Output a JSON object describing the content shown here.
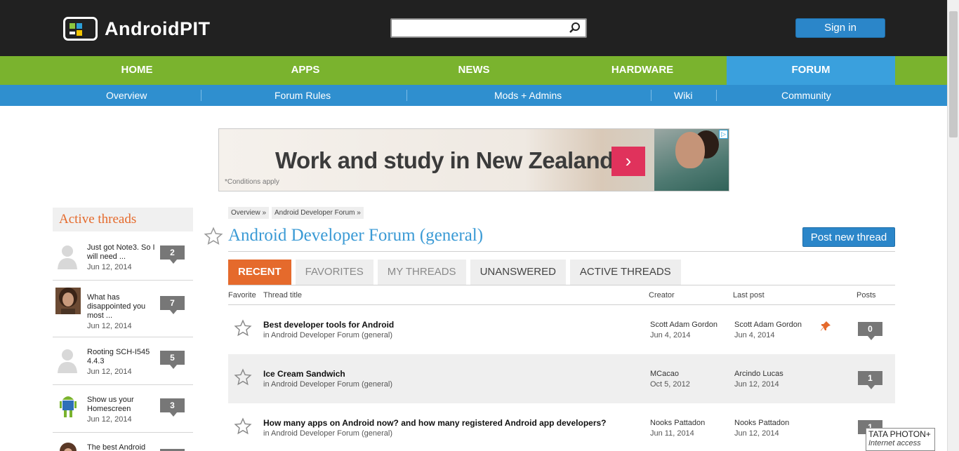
{
  "header": {
    "logo_text": "AndroidPIT",
    "search": {
      "value": "",
      "placeholder": ""
    },
    "signin_label": "Sign in"
  },
  "mainnav": [
    {
      "label": "HOME"
    },
    {
      "label": "APPS"
    },
    {
      "label": "NEWS"
    },
    {
      "label": "HARDWARE"
    },
    {
      "label": "FORUM",
      "active": true
    }
  ],
  "subnav": [
    {
      "label": "Overview"
    },
    {
      "label": "Forum Rules"
    },
    {
      "label": "Mods + Admins"
    },
    {
      "label": "Wiki"
    },
    {
      "label": "Community"
    }
  ],
  "ad": {
    "headline": "Work and study in New Zealand*",
    "conditions": "*Conditions apply",
    "arrow": "›",
    "badge": "▷"
  },
  "sidebar": {
    "title": "Active threads",
    "threads": [
      {
        "text": "Just got Note3. So I will need ...",
        "date": "Jun 12, 2014",
        "count": "2",
        "avatar": "default-avatar"
      },
      {
        "text": "What has disappointed you most ...",
        "date": "Jun 12, 2014",
        "count": "7",
        "avatar": "man-avatar"
      },
      {
        "text": "Rooting SCH-I545 4.4.3",
        "date": "Jun 12, 2014",
        "count": "5",
        "avatar": "default-avatar"
      },
      {
        "text": "Show us your Homescreen",
        "date": "Jun 12, 2014",
        "count": "3",
        "avatar": "android-avatar"
      },
      {
        "text": "The best Android",
        "date": "",
        "count": "",
        "avatar": "woman-avatar"
      }
    ]
  },
  "breadcrumbs": [
    "Overview »",
    "Android Developer Forum »"
  ],
  "forum": {
    "title": "Android Developer Forum (general)",
    "post_button": "Post new thread"
  },
  "tabs": [
    {
      "label": "RECENT",
      "active": true
    },
    {
      "label": "FAVORITES"
    },
    {
      "label": "MY THREADS"
    },
    {
      "label": "UNANSWERED"
    },
    {
      "label": "ACTIVE THREADS"
    }
  ],
  "table": {
    "headers": {
      "favorite": "Favorite",
      "title": "Thread title",
      "creator": "Creator",
      "last_post": "Last post",
      "posts": "Posts"
    },
    "rows": [
      {
        "title": "Best developer tools for Android",
        "sub": "in Android Developer Forum (general)",
        "creator": "Scott Adam Gordon",
        "created": "Jun 4, 2014",
        "last_by": "Scott Adam Gordon",
        "last_date": "Jun 4, 2014",
        "posts": "0",
        "pinned": true
      },
      {
        "title": "Ice Cream Sandwich",
        "sub": "in Android Developer Forum (general)",
        "creator": "MCacao",
        "created": "Oct 5, 2012",
        "last_by": "Arcindo Lucas",
        "last_date": "Jun 12, 2014",
        "posts": "1",
        "pinned": false
      },
      {
        "title": "How many apps on Android now? and how many registered Android app developers?",
        "sub": "in Android Developer Forum (general)",
        "creator": "Nooks Pattadon",
        "created": "Jun 11, 2014",
        "last_by": "Nooks Pattadon",
        "last_date": "Jun 12, 2014",
        "posts": "1",
        "pinned": false
      }
    ]
  },
  "tooltip": {
    "line1": "TATA PHOTON+",
    "line2": "Internet access"
  },
  "colors": {
    "accent_green": "#7ab32e",
    "accent_blue": "#3aa0dd",
    "accent_orange": "#e56a2c"
  }
}
